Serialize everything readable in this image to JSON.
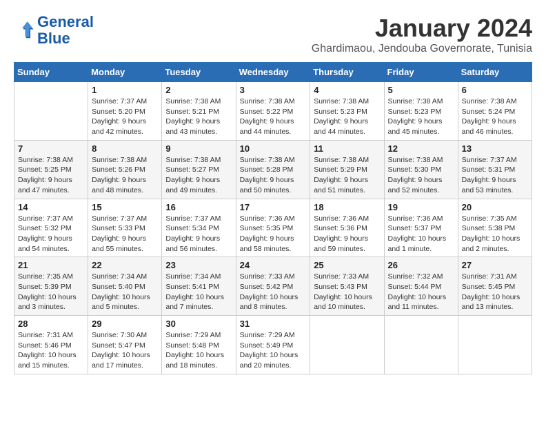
{
  "logo": {
    "name_line1": "General",
    "name_line2": "Blue"
  },
  "title": "January 2024",
  "subtitle": "Ghardimaou, Jendouba Governorate, Tunisia",
  "days_of_week": [
    "Sunday",
    "Monday",
    "Tuesday",
    "Wednesday",
    "Thursday",
    "Friday",
    "Saturday"
  ],
  "weeks": [
    [
      {
        "day": "",
        "sunrise": "",
        "sunset": "",
        "daylight": ""
      },
      {
        "day": "1",
        "sunrise": "7:37 AM",
        "sunset": "5:20 PM",
        "daylight": "9 hours and 42 minutes."
      },
      {
        "day": "2",
        "sunrise": "7:38 AM",
        "sunset": "5:21 PM",
        "daylight": "9 hours and 43 minutes."
      },
      {
        "day": "3",
        "sunrise": "7:38 AM",
        "sunset": "5:22 PM",
        "daylight": "9 hours and 44 minutes."
      },
      {
        "day": "4",
        "sunrise": "7:38 AM",
        "sunset": "5:23 PM",
        "daylight": "9 hours and 44 minutes."
      },
      {
        "day": "5",
        "sunrise": "7:38 AM",
        "sunset": "5:23 PM",
        "daylight": "9 hours and 45 minutes."
      },
      {
        "day": "6",
        "sunrise": "7:38 AM",
        "sunset": "5:24 PM",
        "daylight": "9 hours and 46 minutes."
      }
    ],
    [
      {
        "day": "7",
        "sunrise": "7:38 AM",
        "sunset": "5:25 PM",
        "daylight": "9 hours and 47 minutes."
      },
      {
        "day": "8",
        "sunrise": "7:38 AM",
        "sunset": "5:26 PM",
        "daylight": "9 hours and 48 minutes."
      },
      {
        "day": "9",
        "sunrise": "7:38 AM",
        "sunset": "5:27 PM",
        "daylight": "9 hours and 49 minutes."
      },
      {
        "day": "10",
        "sunrise": "7:38 AM",
        "sunset": "5:28 PM",
        "daylight": "9 hours and 50 minutes."
      },
      {
        "day": "11",
        "sunrise": "7:38 AM",
        "sunset": "5:29 PM",
        "daylight": "9 hours and 51 minutes."
      },
      {
        "day": "12",
        "sunrise": "7:38 AM",
        "sunset": "5:30 PM",
        "daylight": "9 hours and 52 minutes."
      },
      {
        "day": "13",
        "sunrise": "7:37 AM",
        "sunset": "5:31 PM",
        "daylight": "9 hours and 53 minutes."
      }
    ],
    [
      {
        "day": "14",
        "sunrise": "7:37 AM",
        "sunset": "5:32 PM",
        "daylight": "9 hours and 54 minutes."
      },
      {
        "day": "15",
        "sunrise": "7:37 AM",
        "sunset": "5:33 PM",
        "daylight": "9 hours and 55 minutes."
      },
      {
        "day": "16",
        "sunrise": "7:37 AM",
        "sunset": "5:34 PM",
        "daylight": "9 hours and 56 minutes."
      },
      {
        "day": "17",
        "sunrise": "7:36 AM",
        "sunset": "5:35 PM",
        "daylight": "9 hours and 58 minutes."
      },
      {
        "day": "18",
        "sunrise": "7:36 AM",
        "sunset": "5:36 PM",
        "daylight": "9 hours and 59 minutes."
      },
      {
        "day": "19",
        "sunrise": "7:36 AM",
        "sunset": "5:37 PM",
        "daylight": "10 hours and 1 minute."
      },
      {
        "day": "20",
        "sunrise": "7:35 AM",
        "sunset": "5:38 PM",
        "daylight": "10 hours and 2 minutes."
      }
    ],
    [
      {
        "day": "21",
        "sunrise": "7:35 AM",
        "sunset": "5:39 PM",
        "daylight": "10 hours and 3 minutes."
      },
      {
        "day": "22",
        "sunrise": "7:34 AM",
        "sunset": "5:40 PM",
        "daylight": "10 hours and 5 minutes."
      },
      {
        "day": "23",
        "sunrise": "7:34 AM",
        "sunset": "5:41 PM",
        "daylight": "10 hours and 7 minutes."
      },
      {
        "day": "24",
        "sunrise": "7:33 AM",
        "sunset": "5:42 PM",
        "daylight": "10 hours and 8 minutes."
      },
      {
        "day": "25",
        "sunrise": "7:33 AM",
        "sunset": "5:43 PM",
        "daylight": "10 hours and 10 minutes."
      },
      {
        "day": "26",
        "sunrise": "7:32 AM",
        "sunset": "5:44 PM",
        "daylight": "10 hours and 11 minutes."
      },
      {
        "day": "27",
        "sunrise": "7:31 AM",
        "sunset": "5:45 PM",
        "daylight": "10 hours and 13 minutes."
      }
    ],
    [
      {
        "day": "28",
        "sunrise": "7:31 AM",
        "sunset": "5:46 PM",
        "daylight": "10 hours and 15 minutes."
      },
      {
        "day": "29",
        "sunrise": "7:30 AM",
        "sunset": "5:47 PM",
        "daylight": "10 hours and 17 minutes."
      },
      {
        "day": "30",
        "sunrise": "7:29 AM",
        "sunset": "5:48 PM",
        "daylight": "10 hours and 18 minutes."
      },
      {
        "day": "31",
        "sunrise": "7:29 AM",
        "sunset": "5:49 PM",
        "daylight": "10 hours and 20 minutes."
      },
      {
        "day": "",
        "sunrise": "",
        "sunset": "",
        "daylight": ""
      },
      {
        "day": "",
        "sunrise": "",
        "sunset": "",
        "daylight": ""
      },
      {
        "day": "",
        "sunrise": "",
        "sunset": "",
        "daylight": ""
      }
    ]
  ],
  "labels": {
    "sunrise_prefix": "Sunrise: ",
    "sunset_prefix": "Sunset: ",
    "daylight_prefix": "Daylight: "
  }
}
